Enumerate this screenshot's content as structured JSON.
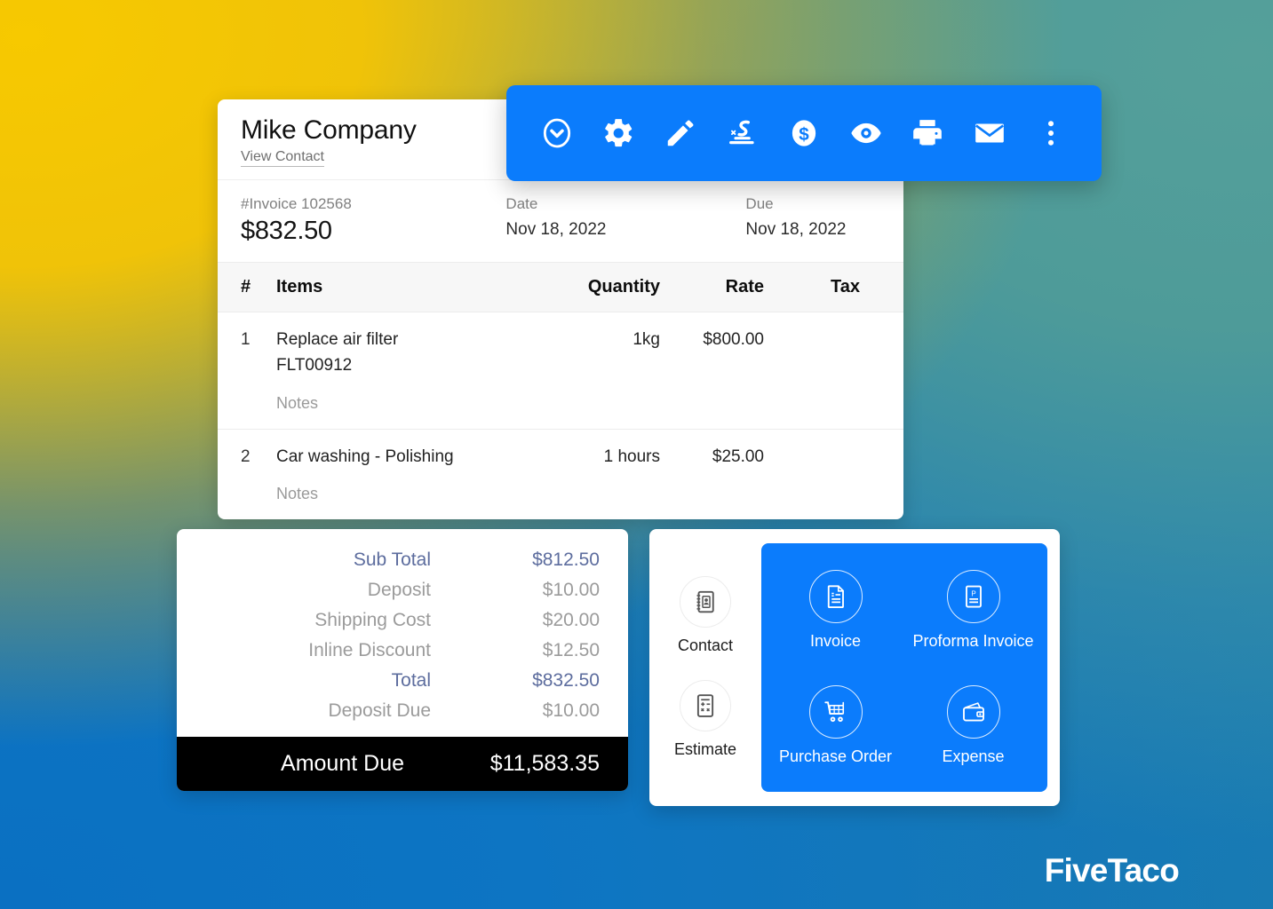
{
  "background": {
    "gradient_colors": [
      "#F7C900",
      "#4E9A93",
      "#0A70C2",
      "#1A7CB0"
    ]
  },
  "accent_color": "#0B7CFC",
  "invoice": {
    "company_name": "Mike Company",
    "view_contact_link": "View Contact",
    "number_label": "#Invoice 102568",
    "amount": "$832.50",
    "date_label": "Date",
    "date_value": "Nov 18, 2022",
    "due_label": "Due",
    "due_value": "Nov 18, 2022",
    "columns": {
      "num": "#",
      "items": "Items",
      "quantity": "Quantity",
      "rate": "Rate",
      "tax": "Tax"
    },
    "rows": [
      {
        "num": "1",
        "item": "Replace air filter",
        "sku": "FLT00912",
        "notes": "Notes",
        "quantity": "1kg",
        "rate": "$800.00",
        "tax": ""
      },
      {
        "num": "2",
        "item": "Car washing - Polishing",
        "sku": "",
        "notes": "Notes",
        "quantity": "1 hours",
        "rate": "$25.00",
        "tax": ""
      }
    ]
  },
  "toolbar": {
    "buttons": [
      {
        "name": "chevron-down-circle-icon",
        "label": "Status"
      },
      {
        "name": "gear-icon",
        "label": "Settings"
      },
      {
        "name": "pencil-icon",
        "label": "Edit"
      },
      {
        "name": "signature-icon",
        "label": "Signature"
      },
      {
        "name": "dollar-circle-icon",
        "label": "Payment"
      },
      {
        "name": "eye-icon",
        "label": "Preview"
      },
      {
        "name": "print-icon",
        "label": "Print"
      },
      {
        "name": "email-icon",
        "label": "Email"
      },
      {
        "name": "more-vertical-icon",
        "label": "More"
      }
    ]
  },
  "totals": {
    "rows": [
      {
        "label": "Sub Total",
        "value": "$812.50",
        "accent": true
      },
      {
        "label": "Deposit",
        "value": "$10.00",
        "accent": false
      },
      {
        "label": "Shipping Cost",
        "value": "$20.00",
        "accent": false
      },
      {
        "label": "Inline Discount",
        "value": "$12.50",
        "accent": false
      },
      {
        "label": "Total",
        "value": "$832.50",
        "accent": true
      },
      {
        "label": "Deposit Due",
        "value": "$10.00",
        "accent": false
      }
    ],
    "amount_due_label": "Amount Due",
    "amount_due_value": "$11,583.35"
  },
  "doc_picker": {
    "left_items": [
      {
        "label": "Contact",
        "icon": "contact-book-icon"
      },
      {
        "label": "Estimate",
        "icon": "calculator-icon"
      }
    ],
    "highlighted_items": [
      {
        "label": "Invoice",
        "icon": "invoice-document-icon"
      },
      {
        "label": "Proforma Invoice",
        "icon": "proforma-document-icon"
      },
      {
        "label": "Purchase Order",
        "icon": "shopping-cart-icon"
      },
      {
        "label": "Expense",
        "icon": "wallet-icon"
      }
    ]
  },
  "branding": {
    "logo_text": "FiveTaco"
  }
}
